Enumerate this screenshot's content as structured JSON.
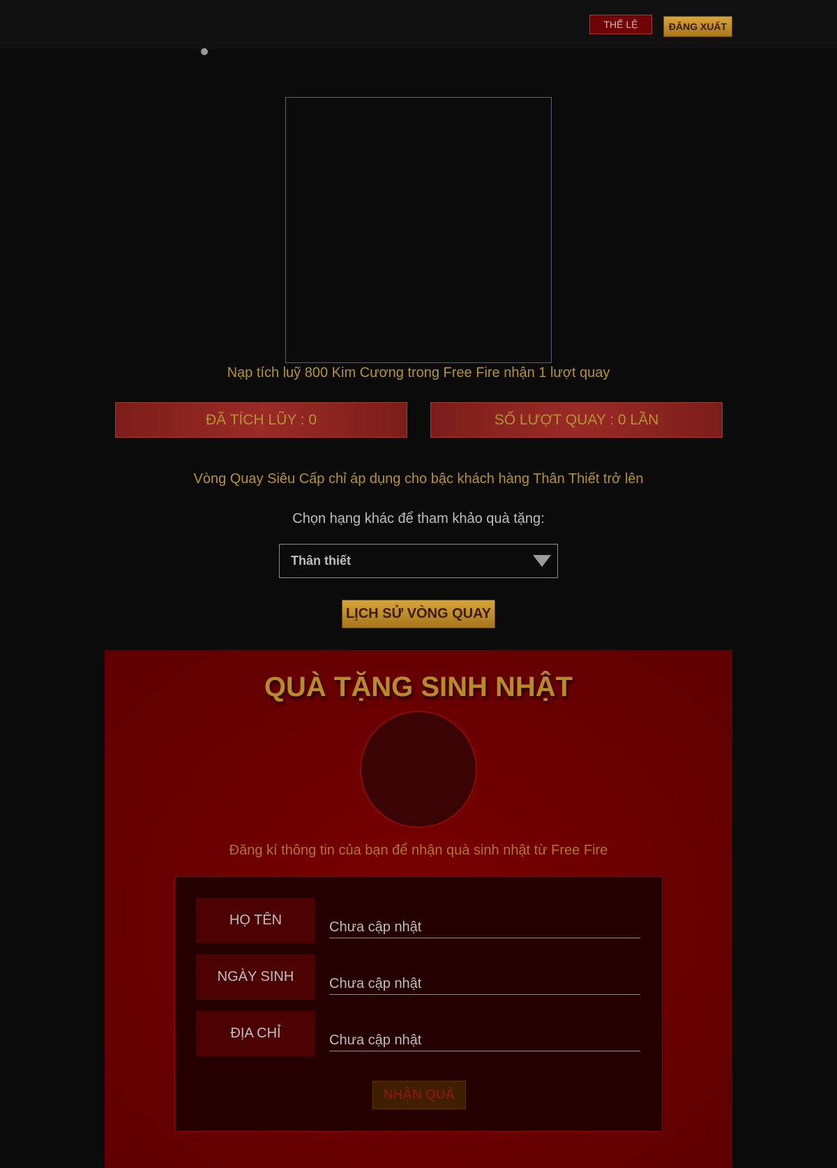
{
  "header": {
    "rules_label": "THỂ LỆ",
    "logout_label": "ĐĂNG XUẤT"
  },
  "wheel": {
    "caption": "Nạp tích luỹ 800 Kim Cương trong Free Fire nhận 1 lượt quay"
  },
  "stats": {
    "accumulated": "ĐÃ TÍCH LŨY : 0",
    "spins": "SỐ LƯỢT QUAY : 0 LẦN"
  },
  "notice": "Vòng Quay Siêu Cấp chỉ áp dụng cho bậc khách hàng Thân Thiết trở lên",
  "tier": {
    "prompt": "Chọn hạng khác để tham khảo quà tặng:",
    "selected": "Thân thiết"
  },
  "history_label": "LỊCH SỬ VÒNG QUAY",
  "birthday": {
    "title": "QUÀ TẶNG SINH NHẬT",
    "subtitle": "Đăng kí thông tin của bạn để nhận quà sinh nhật từ Free Fire",
    "fields": [
      {
        "label": "HỌ TÊN",
        "value": "Chưa cập nhật"
      },
      {
        "label": "NGÀY SINH",
        "value": "Chưa cập nhật"
      },
      {
        "label": "ĐỊA CHỈ",
        "value": "Chưa cập nhật"
      }
    ],
    "claim_label": "NHẬN QUÀ"
  },
  "colors": {
    "background": "#0b0b0b",
    "gold": "#b69236",
    "panel_red": "#680000",
    "form_dark": "#240000"
  }
}
